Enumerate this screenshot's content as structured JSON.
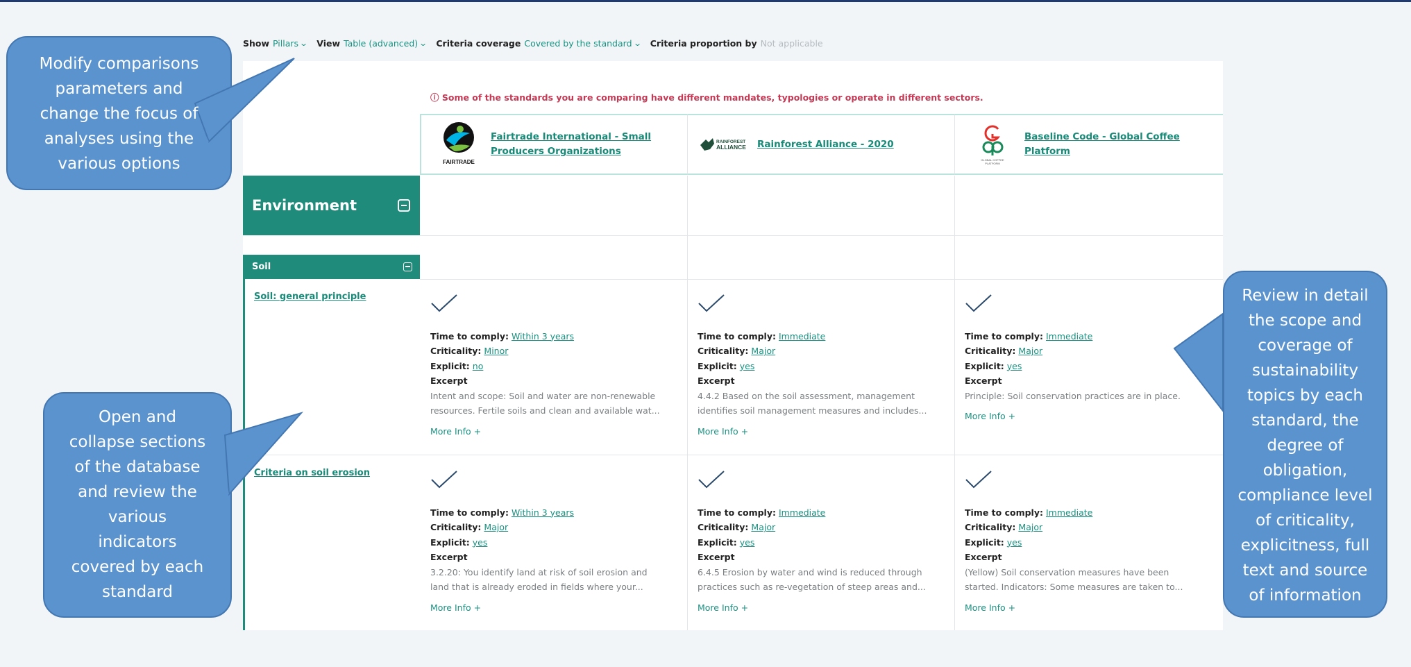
{
  "filters": [
    {
      "label": "Show",
      "value": "Pillars",
      "chevron": true,
      "muted": false
    },
    {
      "label": "View",
      "value": "Table (advanced)",
      "chevron": true,
      "muted": false
    },
    {
      "label": "Criteria coverage",
      "value": "Covered by the standard",
      "chevron": true,
      "muted": false
    },
    {
      "label": "Criteria proportion by",
      "value": "Not applicable",
      "chevron": false,
      "muted": true
    }
  ],
  "warning": "ⓘ Some of the standards you are comparing have different mandates, typologies or operate in different sectors.",
  "standards": [
    {
      "name": "Fairtrade International - Small Producers Organizations",
      "logo_text": "FAIRTRADE",
      "logo_icon": "fairtrade-logo"
    },
    {
      "name": "Rainforest Alliance - 2020",
      "logo_text": "RAINFOREST ALLIANCE",
      "logo_icon": "rainforest-alliance-logo"
    },
    {
      "name": "Baseline Code - Global Coffee Platform",
      "logo_text": "GLOBAL COFFEE PLATFORM",
      "logo_icon": "global-coffee-platform-logo"
    }
  ],
  "pillar": {
    "title": "Environment"
  },
  "section": {
    "title": "Soil"
  },
  "labels": {
    "time": "Time to comply:",
    "criticality": "Criticality:",
    "explicit": "Explicit:",
    "excerpt": "Excerpt",
    "more": "More Info +"
  },
  "indicators": [
    {
      "name": "Soil: general principle",
      "cells": [
        {
          "time": "Within 3 years",
          "criticality": "Minor",
          "explicit": "no",
          "text1": "Intent and scope: Soil and water are non-renewable",
          "text2": "resources. Fertile soils and clean and available wat..."
        },
        {
          "time": "Immediate",
          "criticality": "Major",
          "explicit": "yes",
          "text1": "4.4.2 Based on the soil assessment, management",
          "text2": "identifies soil management measures and includes..."
        },
        {
          "time": "Immediate",
          "criticality": "Major",
          "explicit": "yes",
          "text1": "Principle: Soil conservation practices are in place.",
          "text2": ""
        }
      ]
    },
    {
      "name": "Criteria on soil erosion",
      "cells": [
        {
          "time": "Within 3 years",
          "criticality": "Major",
          "explicit": "yes",
          "text1": "3.2.20: You identify land at risk of soil erosion and",
          "text2": "land that is already eroded in fields where your..."
        },
        {
          "time": "Immediate",
          "criticality": "Major",
          "explicit": "yes",
          "text1": "6.4.5 Erosion by water and wind is reduced through",
          "text2": "practices such as re-vegetation of steep areas and..."
        },
        {
          "time": "Immediate",
          "criticality": "Major",
          "explicit": "yes",
          "text1": "(Yellow) Soil conservation measures have been",
          "text2": "started. Indicators: Some measures are taken to..."
        }
      ]
    }
  ],
  "callouts": {
    "top_left": [
      "Modify comparisons",
      "parameters and",
      "change the focus of",
      "analyses using the",
      "various options"
    ],
    "bottom_left": [
      "Open and",
      "collapse sections",
      "of the database",
      "and review the",
      "various",
      "indicators",
      "covered by each",
      "standard"
    ],
    "right": [
      "Review in detail",
      "the scope and",
      "coverage of",
      "sustainability",
      "topics by each",
      "standard, the",
      "degree of",
      "obligation,",
      "compliance level",
      "of criticality,",
      "explicitness, full",
      "text and source",
      "of information"
    ]
  },
  "colors": {
    "teal": "#1f8b7a",
    "link": "#1a9180",
    "warning": "#c43a55",
    "callout": "#5b93cf"
  }
}
